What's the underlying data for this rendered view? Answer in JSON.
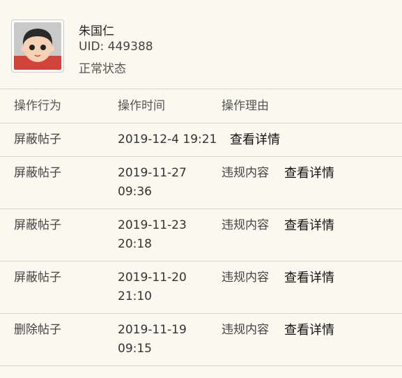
{
  "user": {
    "name": "朱国仁",
    "uid": "UID: 449388",
    "status": "正常状态"
  },
  "table": {
    "headers": [
      "操作行为",
      "操作时间",
      "操作理由"
    ],
    "rows": [
      {
        "action": "屏蔽帖子",
        "time_line1": "2019-12-4 19:21",
        "time_line2": "",
        "reason": "",
        "link": "查看详情"
      },
      {
        "action": "屏蔽帖子",
        "time_line1": "2019-11-27",
        "time_line2": "09:36",
        "reason": "违规内容",
        "link": "查看详情"
      },
      {
        "action": "屏蔽帖子",
        "time_line1": "2019-11-23",
        "time_line2": "20:18",
        "reason": "违规内容",
        "link": "查看详情"
      },
      {
        "action": "屏蔽帖子",
        "time_line1": "2019-11-20",
        "time_line2": "21:10",
        "reason": "违规内容",
        "link": "查看详情"
      },
      {
        "action": "删除帖子",
        "time_line1": "2019-11-19",
        "time_line2": "09:15",
        "reason": "违规内容",
        "link": "查看详情"
      }
    ]
  }
}
